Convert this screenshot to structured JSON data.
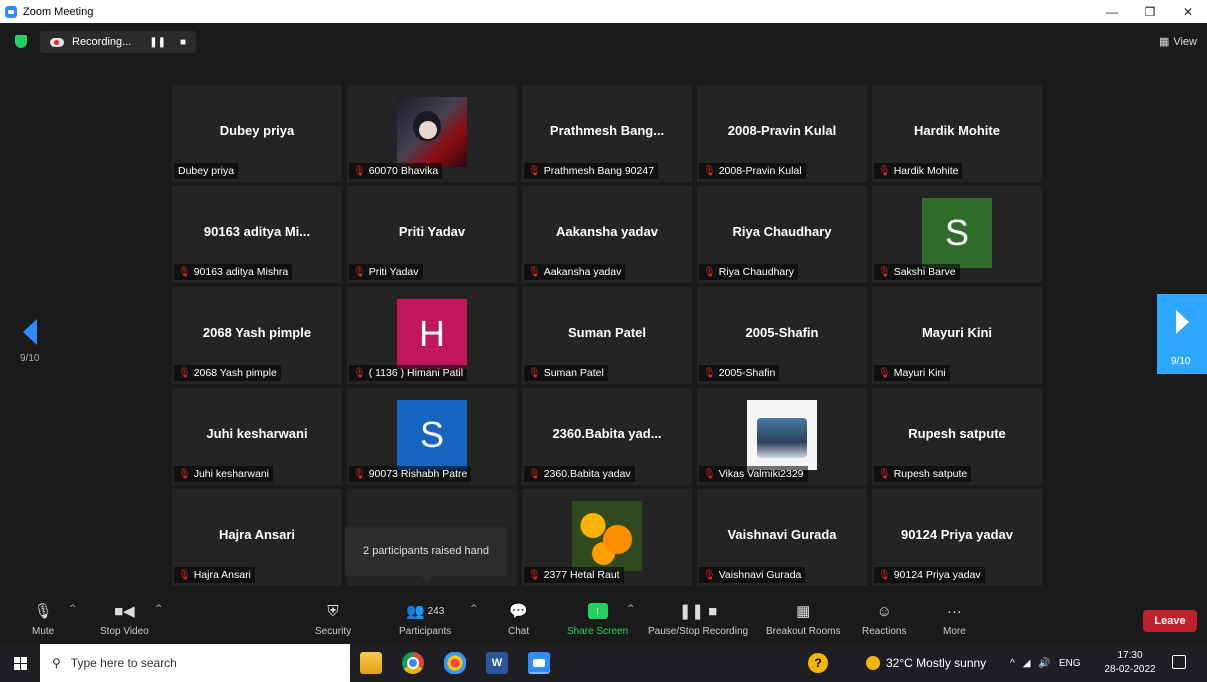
{
  "window": {
    "title": "Zoom Meeting"
  },
  "topbar": {
    "recording_label": "Recording...",
    "view_label": "View"
  },
  "pagination": {
    "left": "9/10",
    "right": "9/10"
  },
  "tooltip": "2 participants raised hand",
  "tiles": [
    {
      "center": "Dubey priya",
      "label": "Dubey priya",
      "muted": false
    },
    {
      "center": "",
      "label": "60070 Bhavika",
      "muted": true,
      "media": "anime-photo"
    },
    {
      "center": "Prathmesh  Bang...",
      "label": "Prathmesh Bang 90247",
      "muted": true
    },
    {
      "center": "2008-Pravin Kulal",
      "label": "2008-Pravin Kulal",
      "muted": true
    },
    {
      "center": "Hardik Mohite",
      "label": "Hardik Mohite",
      "muted": true
    },
    {
      "center": "90163 aditya Mi...",
      "label": "90163 aditya Mishra",
      "muted": true
    },
    {
      "center": "Priti Yadav",
      "label": "Priti Yadav",
      "muted": true
    },
    {
      "center": "Aakansha yadav",
      "label": "Aakansha yadav",
      "muted": true
    },
    {
      "center": "Riya Chaudhary",
      "label": "Riya Chaudhary",
      "muted": true
    },
    {
      "center": "",
      "label": "Sakshi Barve",
      "muted": true,
      "avatar": "S",
      "avatar_color": "#2f6e2a"
    },
    {
      "center": "2068 Yash pimple",
      "label": "2068 Yash pimple",
      "muted": true
    },
    {
      "center": "",
      "label": "( 1136 ) Himani Patil",
      "muted": true,
      "avatar": "H",
      "avatar_color": "#c2185b"
    },
    {
      "center": "Suman Patel",
      "label": "Suman Patel",
      "muted": true
    },
    {
      "center": "2005-Shafin",
      "label": "2005-Shafin",
      "muted": true
    },
    {
      "center": "Mayuri Kini",
      "label": "Mayuri Kini",
      "muted": true
    },
    {
      "center": "Juhi kesharwani",
      "label": "Juhi kesharwani",
      "muted": true
    },
    {
      "center": "",
      "label": "90073 Rishabh Patre",
      "muted": true,
      "avatar": "S",
      "avatar_color": "#1565c0"
    },
    {
      "center": "2360.Babita yad...",
      "label": "2360.Babita yadav",
      "muted": true
    },
    {
      "center": "",
      "label": "Vikas Valmiki2329",
      "muted": true,
      "media": "bike-photo"
    },
    {
      "center": "Rupesh satpute",
      "label": "Rupesh satpute",
      "muted": true
    },
    {
      "center": "Hajra Ansari",
      "label": "Hajra Ansari",
      "muted": true
    },
    {
      "center": "",
      "label": "",
      "muted": false
    },
    {
      "center": "",
      "label": "2377 Hetal Raut",
      "muted": true,
      "media": "flower-photo"
    },
    {
      "center": "Vaishnavi Gurada",
      "label": "Vaishnavi Gurada",
      "muted": true
    },
    {
      "center": "90124 Priya yadav",
      "label": "90124 Priya yadav",
      "muted": true
    }
  ],
  "toolbar": {
    "mute": "Mute",
    "stop_video": "Stop Video",
    "security": "Security",
    "participants": "Participants",
    "participants_count": "243",
    "chat": "Chat",
    "share_screen": "Share Screen",
    "pause_stop_recording": "Pause/Stop Recording",
    "breakout_rooms": "Breakout Rooms",
    "reactions": "Reactions",
    "more": "More",
    "leave": "Leave"
  },
  "taskbar": {
    "search_placeholder": "Type here to search",
    "weather": "32°C  Mostly sunny",
    "lang": "ENG",
    "time": "17:30",
    "date": "28-02-2022"
  },
  "colors": {
    "accent": "#2d8cff",
    "share_green": "#23d160",
    "leave_red": "#c0202b"
  }
}
